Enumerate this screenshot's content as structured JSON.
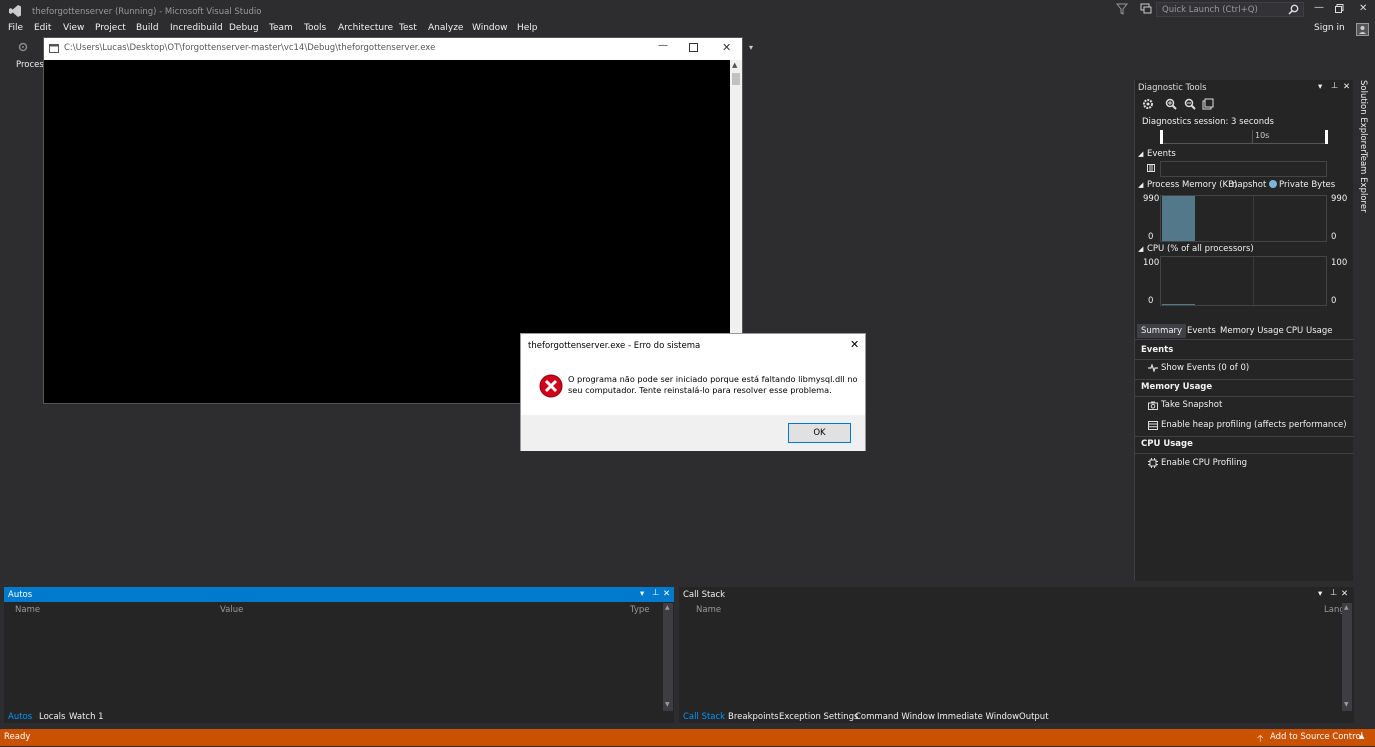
{
  "window": {
    "title": "theforgottenserver (Running) - Microsoft Visual Studio",
    "quick_launch_placeholder": "Quick Launch (Ctrl+Q)",
    "sign_in": "Sign in"
  },
  "menu": [
    "File",
    "Edit",
    "View",
    "Project",
    "Build",
    "Incredibuild",
    "Debug",
    "Team",
    "Tools",
    "Architecture",
    "Test",
    "Analyze",
    "Window",
    "Help"
  ],
  "toolbar": {
    "process_label": "Proces"
  },
  "console": {
    "title": "C:\\Users\\Lucas\\Desktop\\OT\\forgottenserver-master\\vc14\\Debug\\theforgottenserver.exe"
  },
  "dialog": {
    "title": "theforgottenserver.exe - Erro do sistema",
    "message_line1": "O programa não pode ser iniciado porque está faltando libmysql.dll no",
    "message_line2": "seu computador. Tente reinstalá-lo para resolver esse problema.",
    "ok": "OK"
  },
  "diagnostics": {
    "title": "Diagnostic Tools",
    "session": "Diagnostics session: 3 seconds",
    "timeline_tick": "10s",
    "events_label": "Events",
    "memory_label": "Process Memory (KB)",
    "snapshot_label": "napshot",
    "private_bytes": "Private Bytes",
    "memory_max": "990",
    "memory_min": "0",
    "memory_level": 1.0,
    "cpu_label": "CPU (% of all processors)",
    "cpu_max": "100",
    "cpu_min": "0",
    "tabs": [
      "Summary",
      "Events",
      "Memory Usage",
      "CPU Usage"
    ],
    "events_section": "Events",
    "show_events": "Show Events (0 of 0)",
    "memory_section": "Memory Usage",
    "take_snapshot": "Take Snapshot",
    "heap_profiling": "Enable heap profiling (affects performance)",
    "cpu_section": "CPU Usage",
    "cpu_profiling": "Enable CPU Profiling"
  },
  "side_tabs": [
    "Solution Explorer",
    "Team Explorer"
  ],
  "autos": {
    "title": "Autos",
    "columns": [
      "Name",
      "Value",
      "Type"
    ],
    "tabs": [
      "Autos",
      "Locals",
      "Watch 1"
    ]
  },
  "callstack": {
    "title": "Call Stack",
    "columns": [
      "Name",
      "Lang"
    ],
    "tabs": [
      "Call Stack",
      "Breakpoints",
      "Exception Settings",
      "Command Window",
      "Immediate Window",
      "Output"
    ]
  },
  "status": {
    "text": "Ready",
    "source_control": "Add to Source Control"
  },
  "colors": {
    "accent": "#007acc",
    "status": "#ca5100",
    "error": "#d0021b"
  }
}
